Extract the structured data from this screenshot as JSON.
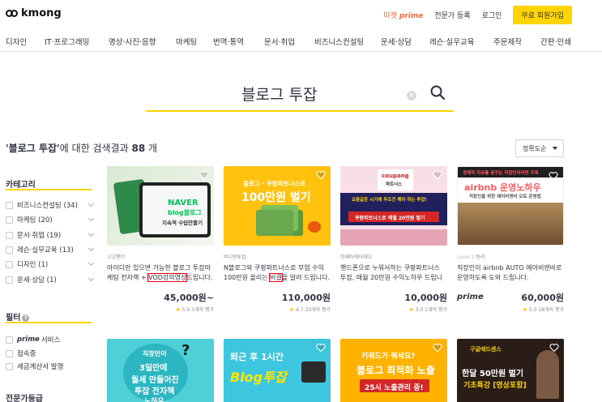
{
  "header": {
    "logo": "kmong",
    "links": {
      "prime_prefix": "마켓",
      "prime_word": "prime",
      "expert": "전문가 등록",
      "login": "로그인"
    },
    "join_button": "무료 회원가입"
  },
  "categories": [
    "디자인",
    "IT·프로그래밍",
    "영상·사진·음향",
    "마케팅",
    "번역·통역",
    "문서·취업",
    "비즈니스컨설팅",
    "운세·상담",
    "레슨·실무교육",
    "주문제작",
    "간판·인쇄"
  ],
  "search": {
    "query": "블로그 투잡",
    "clear": "×"
  },
  "results": {
    "quote": "'블로그 투잡'",
    "suffix": "에 대한 검색결과",
    "count": "88",
    "unit": "개",
    "sort": "정확도순"
  },
  "sidebar": {
    "category_title": "카테고리",
    "categories": [
      {
        "label": "비즈니스컨설팅 (34)"
      },
      {
        "label": "마케팅 (20)"
      },
      {
        "label": "문서·취업 (19)"
      },
      {
        "label": "레슨·실무교육 (13)"
      },
      {
        "label": "디자인 (1)"
      },
      {
        "label": "운세·상담 (1)"
      }
    ],
    "filter_title": "필터",
    "filters": {
      "prime_word": "prime",
      "prime_rest": "서비스",
      "fast": "접속중",
      "tax": "세금계산서 발행"
    },
    "grade_title": "전문가등급"
  },
  "cards": [
    {
      "seller": "고고핸더",
      "desc_a": "아이디만 있으면 가능한 블로그 투잡마케팅 전자책 + ",
      "desc_hl": "VOD강의영상",
      "desc_b": "드립니다.",
      "price": "45,000원~",
      "rating": "5.0 3개의 평가",
      "thumb": {
        "l1": "NAVER",
        "l2": "blog블로그",
        "l3": "지속적 수입만들기"
      }
    },
    {
      "seller": "비니랑투잡",
      "desc_a": "N블로그와 쿠팡파트너스로 부업 수익 100만원 올리는 ",
      "desc_hl": "비결",
      "desc_b": "을 알려 드립니다.",
      "price": "110,000원",
      "rating": "4.7 33개의 평가",
      "thumb": {
        "l1": "블로그 · 쿠팡파트너스로",
        "l2": "100만원 벌기"
      }
    },
    {
      "seller": "현재마케터대디",
      "desc_a": "핸드폰으로 누워서하는 쿠팡파트너스 투잡, 매월 20만원 수익노하우 드립니다.",
      "desc_hl": "",
      "desc_b": "",
      "price": "10,000원",
      "rating": "3.0 1개의 평가",
      "thumb": {
        "l1": "coupang",
        "l2": "파트너스",
        "l3": "요즘같은 시기에 무조건 해야 하는 투잡!",
        "l4": "쿠팡파트너스로 매월 20만원 벌기"
      }
    },
    {
      "seller_level": "Level 2",
      "seller": "동리",
      "desc_a": "직장인이 airbnb AUTO 에어비앤비로 운영하도록 도와 드립니다.",
      "desc_hl": "",
      "desc_b": "",
      "prime": "prime",
      "price": "60,000원",
      "rating": "5.0 18개의 평가",
      "thumb": {
        "l1": "경제적 자유를 꿈꾸는 직장인이라면 주목",
        "l2": "airbnb 운영노하우",
        "l3": "직장인을 위한 에어비앤비 오토 운영법"
      }
    }
  ],
  "cards_row2": [
    {
      "l1": "직장인이",
      "l2": "3일만에",
      "l3": "월세 만들어진",
      "l4": "투잡 전자책",
      "l5": "노하우"
    },
    {
      "l1": "퇴근 후 1시간",
      "l2": "Blog투잡"
    },
    {
      "l1": "키워드가 뭐세요?",
      "l2": "블로그 최적화 노출",
      "l3": "25시 노출관리 중!"
    },
    {
      "l1": "구글애드센스",
      "l2": "한달 50만원 벌기",
      "l3": "기초특강 [영상포함]"
    }
  ],
  "colors": {
    "accent": "#ffd400",
    "highlight": "#e60012",
    "prime": "#ff6b35"
  }
}
